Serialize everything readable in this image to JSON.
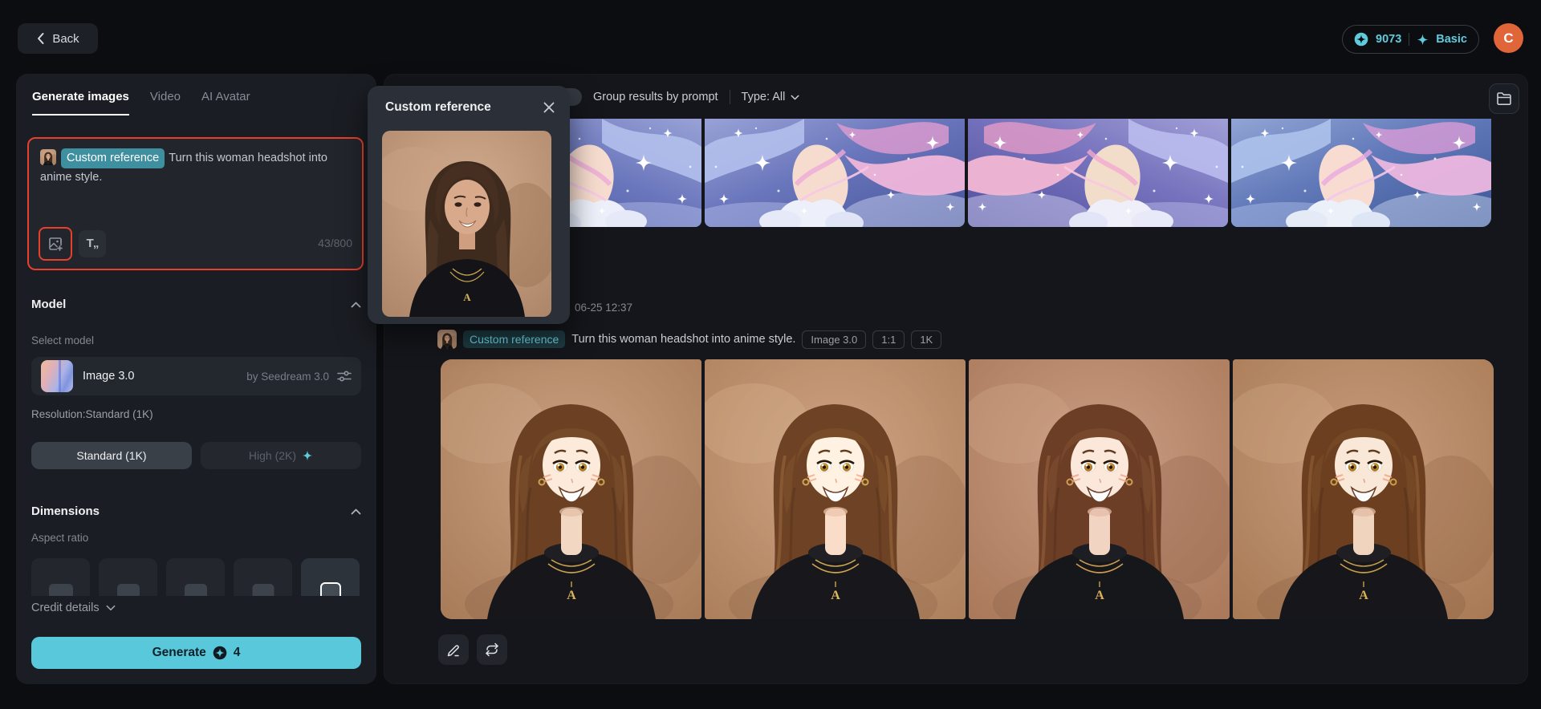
{
  "topbar": {
    "back_label": "Back",
    "credits": "9073",
    "plan": "Basic",
    "avatar_letter": "C"
  },
  "sidebar": {
    "tabs": [
      {
        "label": "Generate images",
        "active": true
      },
      {
        "label": "Video",
        "active": false
      },
      {
        "label": "AI Avatar",
        "active": false
      }
    ],
    "prompt": {
      "reference_tag": "Custom reference",
      "text": "Turn this woman headshot into anime style.",
      "char_count": "43/800"
    },
    "model": {
      "heading": "Model",
      "select_label": "Select model",
      "name": "Image 3.0",
      "by": "by Seedream 3.0",
      "resolution_label": "Resolution:Standard (1K)",
      "standard_option": "Standard (1K)",
      "high_option": "High (2K)"
    },
    "dimensions": {
      "heading": "Dimensions",
      "aspect_label": "Aspect ratio"
    },
    "credit_details_label": "Credit details",
    "generate_label": "Generate",
    "generate_cost": "4"
  },
  "reference_popup": {
    "title": "Custom reference"
  },
  "results": {
    "group_toggle_label": "Group results by prompt",
    "type_filter": "Type: All",
    "entry": {
      "timestamp": "06-25 12:37",
      "reference_tag": "Custom reference",
      "prompt": "Turn this woman headshot into anime style.",
      "tags": [
        "Image 3.0",
        "1:1",
        "1K"
      ]
    }
  },
  "colors": {
    "accent_cyan": "#5fcbdd",
    "alert_red": "#e8402c",
    "avatar_orange": "#e0663a",
    "reference_tag_bg": "#3e8fa0",
    "generate_button": "#58c8da"
  }
}
